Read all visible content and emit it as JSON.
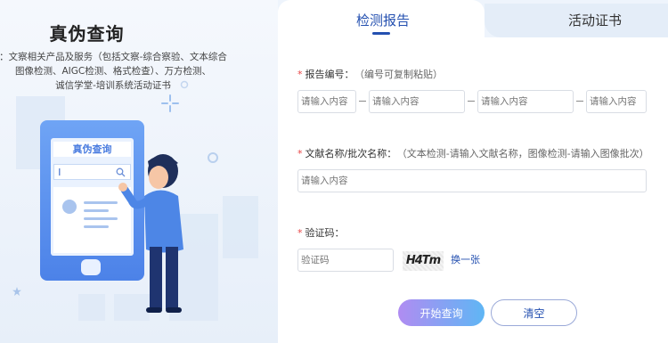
{
  "left": {
    "title": "真伪查询",
    "description_lines": [
      "：文察相关产品及服务（包括文察-综合察验、文本综合",
      "图像检测、AIGC检测、格式检查）、万方检测、",
      "诚信学堂-培训系统活动证书"
    ],
    "phone": {
      "title": "真伪查询"
    }
  },
  "tabs": [
    {
      "label": "检测报告",
      "active": true
    },
    {
      "label": "活动证书",
      "active": false
    }
  ],
  "form": {
    "report_number": {
      "label": "报告编号：",
      "hint": "（编号可复制粘贴）",
      "placeholders": [
        "请输入内容",
        "请输入内容",
        "请输入内容",
        "请输入内容"
      ]
    },
    "doc_name": {
      "label": "文献名称/批次名称：",
      "hint": "（文本检测-请输入文献名称，图像检测-请输入图像批次）",
      "placeholder": "请输入内容"
    },
    "captcha": {
      "label": "验证码：",
      "placeholder": "验证码",
      "image_text": "H4Tm",
      "refresh_label": "换一张"
    },
    "buttons": {
      "query": "开始查询",
      "clear": "清空"
    }
  },
  "colors": {
    "accent": "#2450b0",
    "required_star": "#e84545"
  }
}
